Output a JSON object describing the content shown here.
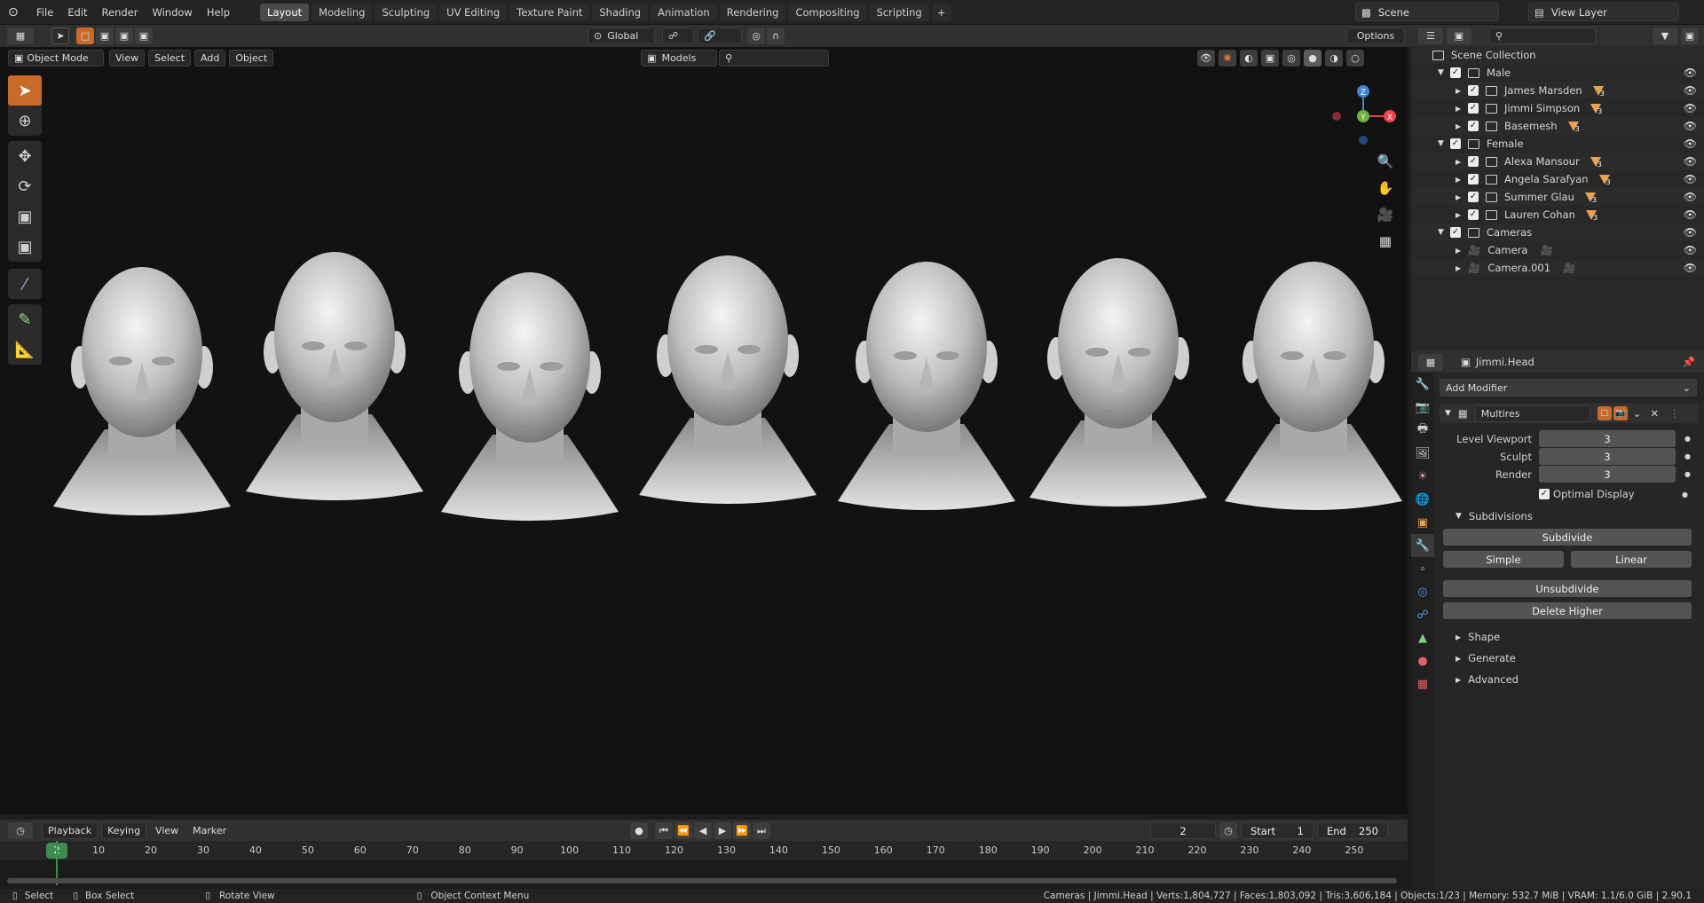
{
  "menu": {
    "items": [
      "File",
      "Edit",
      "Render",
      "Window",
      "Help"
    ]
  },
  "workspaces": [
    {
      "label": "Layout",
      "active": true
    },
    {
      "label": "Modeling",
      "active": false
    },
    {
      "label": "Sculpting",
      "active": false
    },
    {
      "label": "UV Editing",
      "active": false
    },
    {
      "label": "Texture Paint",
      "active": false
    },
    {
      "label": "Shading",
      "active": false
    },
    {
      "label": "Animation",
      "active": false
    },
    {
      "label": "Rendering",
      "active": false
    },
    {
      "label": "Compositing",
      "active": false
    },
    {
      "label": "Scripting",
      "active": false
    }
  ],
  "workspace_add": "+",
  "scene": {
    "name": "Scene",
    "view_layer": "View Layer"
  },
  "toolbar": {
    "transform_orientation": "Global",
    "options": "Options"
  },
  "viewport_header": {
    "mode": "Object Mode",
    "view": "View",
    "select": "Select",
    "add": "Add",
    "object": "Object",
    "collection_filter": "Models"
  },
  "gizmo": {
    "z": "Z",
    "y": "Y",
    "x": "X"
  },
  "heads": 7,
  "outliner": {
    "root": "Scene Collection",
    "rows": [
      {
        "label": "Male",
        "level": 1,
        "type": "collection"
      },
      {
        "label": "James Marsden",
        "level": 2,
        "type": "mesh",
        "badge": "3"
      },
      {
        "label": "Jimmi Simpson",
        "level": 2,
        "type": "mesh",
        "badge": "3"
      },
      {
        "label": "Basemesh",
        "level": 2,
        "type": "mesh",
        "badge": "3"
      },
      {
        "label": "Female",
        "level": 1,
        "type": "collection"
      },
      {
        "label": "Alexa Mansour",
        "level": 2,
        "type": "mesh",
        "badge": "3"
      },
      {
        "label": "Angela Sarafyan",
        "level": 2,
        "type": "mesh",
        "badge": "3"
      },
      {
        "label": "Summer Glau",
        "level": 2,
        "type": "mesh",
        "badge": "3"
      },
      {
        "label": "Lauren Cohan",
        "level": 2,
        "type": "mesh",
        "badge": "3"
      },
      {
        "label": "Cameras",
        "level": 1,
        "type": "collection"
      },
      {
        "label": "Camera",
        "level": 2,
        "type": "camera"
      },
      {
        "label": "Camera.001",
        "level": 2,
        "type": "camera"
      }
    ]
  },
  "properties": {
    "object_name": "Jimmi.Head",
    "add_modifier": "Add Modifier",
    "modifier_name": "Multires",
    "levels": [
      {
        "label": "Level Viewport",
        "value": "3"
      },
      {
        "label": "Sculpt",
        "value": "3"
      },
      {
        "label": "Render",
        "value": "3"
      }
    ],
    "optimal_display": "Optimal Display",
    "subdivisions": "Subdivisions",
    "subdivide": "Subdivide",
    "simple": "Simple",
    "linear": "Linear",
    "unsubdivide": "Unsubdivide",
    "delete_higher": "Delete Higher",
    "sections": [
      "Shape",
      "Generate",
      "Advanced"
    ]
  },
  "timeline": {
    "playback": "Playback",
    "keying": "Keying",
    "view": "View",
    "marker": "Marker",
    "current_frame": "2",
    "start_label": "Start",
    "start": "1",
    "end_label": "End",
    "end": "250",
    "ticks": [
      "10",
      "20",
      "30",
      "40",
      "50",
      "60",
      "70",
      "80",
      "90",
      "100",
      "110",
      "120",
      "130",
      "140",
      "150",
      "160",
      "170",
      "180",
      "190",
      "200",
      "210",
      "220",
      "230",
      "240",
      "250"
    ],
    "playhead_label": "2"
  },
  "status": {
    "select": "Select",
    "box_select": "Box Select",
    "rotate_view": "Rotate View",
    "context_menu": "Object Context Menu",
    "stats": "Cameras | Jimmi.Head | Verts:1,804,727 | Faces:1,803,092 | Tris:3,606,184 | Objects:1/23 | Memory: 532.7 MiB | VRAM: 1.1/6.0 GiB | 2.90.1"
  },
  "colors": {
    "accent": "#c96a2a",
    "mesh_badge": "#e8a152",
    "gizmo_x": "#e8474e",
    "gizmo_y": "#6bb33b",
    "gizmo_z": "#3f82d8"
  }
}
